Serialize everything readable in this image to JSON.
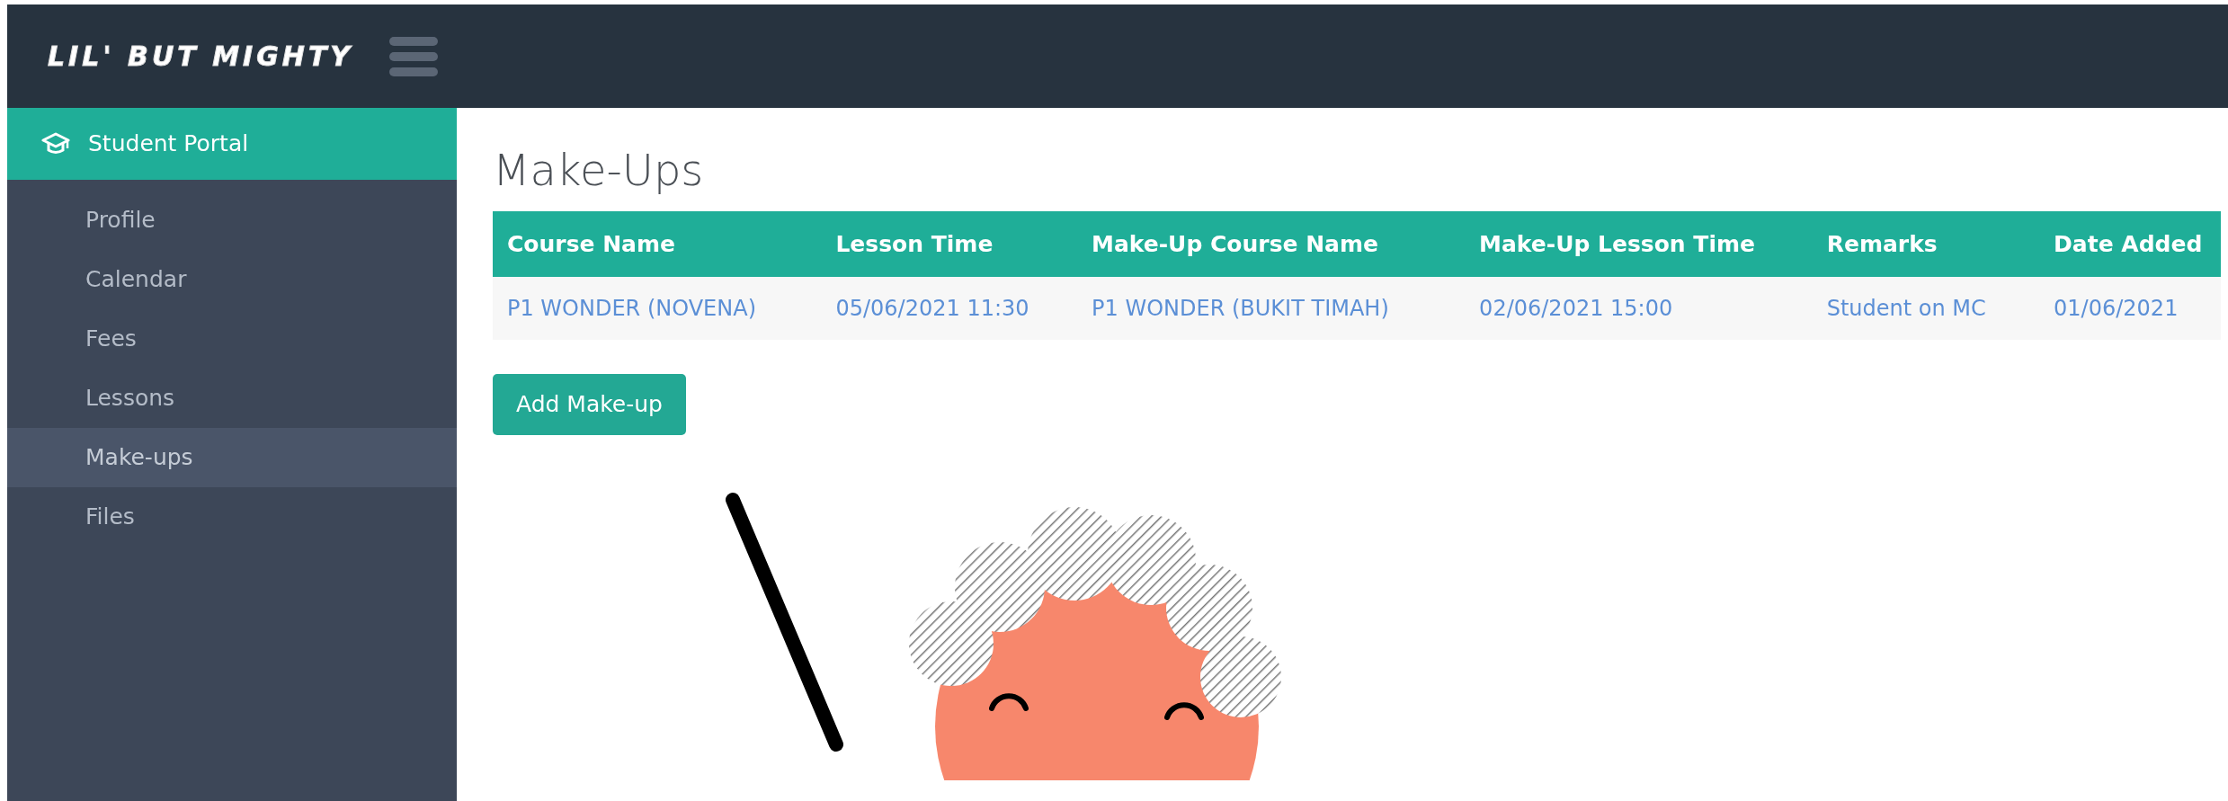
{
  "header": {
    "logo": "LIL' BUT MIGHTY"
  },
  "sidebar": {
    "section": "Student Portal",
    "items": [
      {
        "label": "Profile",
        "selected": false
      },
      {
        "label": "Calendar",
        "selected": false
      },
      {
        "label": "Fees",
        "selected": false
      },
      {
        "label": "Lessons",
        "selected": false
      },
      {
        "label": "Make-ups",
        "selected": true
      },
      {
        "label": "Files",
        "selected": false
      }
    ]
  },
  "page_title": "Make-Ups",
  "table": {
    "columns": [
      "Course Name",
      "Lesson Time",
      "Make-Up Course Name",
      "Make-Up Lesson Time",
      "Remarks",
      "Date Added"
    ],
    "rows": [
      [
        "P1 WONDER (NOVENA)",
        "05/06/2021 11:30",
        "P1 WONDER (BUKIT TIMAH)",
        "02/06/2021 15:00",
        "Student on MC",
        "01/06/2021"
      ]
    ]
  },
  "add_button": "Add Make-up"
}
